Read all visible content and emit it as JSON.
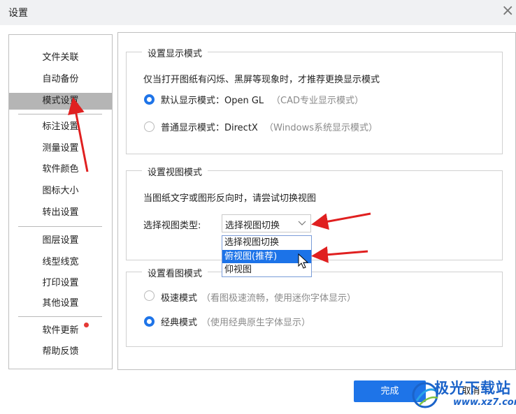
{
  "window": {
    "title": "设置"
  },
  "sidebar": {
    "items": [
      "文件关联",
      "自动备份",
      "模式设置",
      "标注设置",
      "测量设置",
      "软件颜色",
      "图标大小",
      "转出设置",
      "图层设置",
      "线型线宽",
      "打印设置",
      "其他设置",
      "软件更新",
      "帮助反馈"
    ],
    "active": "模式设置"
  },
  "display_mode": {
    "legend": "设置显示模式",
    "hint": "仅当打开图纸有闪烁、黑屏等现象时，才推荐更换显示模式",
    "options": [
      {
        "label": "默认显示模式：Open GL",
        "note": "（CAD专业显示模式）",
        "selected": true
      },
      {
        "label": "普通显示模式：DirectX",
        "note": "（Windows系统显示模式）",
        "selected": false
      }
    ]
  },
  "view_mode": {
    "legend": "设置视图模式",
    "hint": "当图纸文字或图形反向时，请尝试切换视图",
    "type_label": "选择视图类型:",
    "selected_value": "选择视图切换",
    "dropdown_options": [
      "选择视图切换",
      "俯视图(推荐)",
      "仰视图"
    ],
    "hovered_option": "俯视图(推荐)"
  },
  "look_mode": {
    "legend": "设置看图模式",
    "options": [
      {
        "label": "极速模式",
        "note": "（看图极速流畅，使用迷你字体显示）",
        "selected": false
      },
      {
        "label": "经典模式",
        "note": "（使用经典原生字体显示）",
        "selected": true
      }
    ]
  },
  "footer": {
    "ok_label": "完成",
    "cancel_label": "取消"
  },
  "watermark": {
    "brand": "极光下载站",
    "url": "www.xz7.com"
  },
  "colors": {
    "accent": "#1e74e8",
    "annotation_arrow": "#e02020",
    "update_dot": "#e53935",
    "sidebar_active": "#b5b5b5"
  },
  "icons": {
    "close": "close-icon",
    "dropdown": "chevron-down-icon",
    "cursor": "mouse-pointer-icon"
  }
}
